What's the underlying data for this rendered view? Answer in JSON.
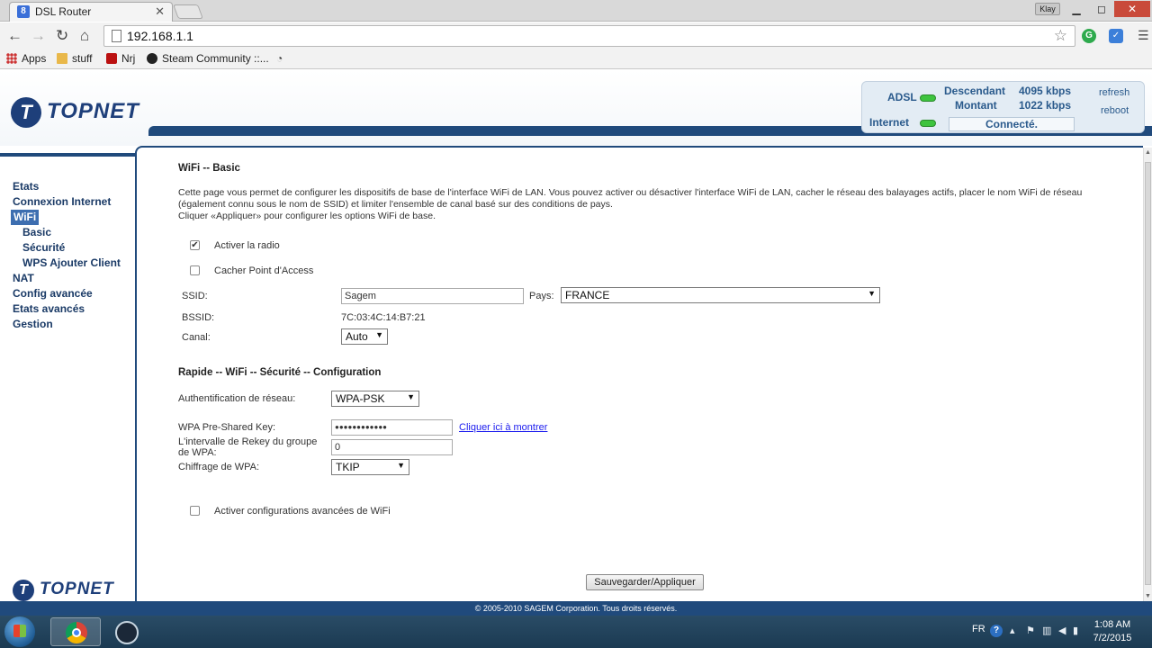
{
  "browser": {
    "tab_title": "DSL Router",
    "tab_favicon": "8",
    "close_glyph": "✕",
    "url": "192.168.1.1",
    "user_badge": "Klay",
    "bookmarks": [
      {
        "label": "Apps",
        "icon": "apps-icon"
      },
      {
        "label": "stuff",
        "icon": "folder-icon"
      },
      {
        "label": "Nrj",
        "icon": "nrj-icon"
      },
      {
        "label": "Steam Community ::...",
        "icon": "steam-icon"
      }
    ]
  },
  "header": {
    "logo_mark": "T",
    "logo_text": "TOPNET",
    "status": {
      "adsl_label": "ADSL",
      "internet_label": "Internet",
      "down_label": "Descendant",
      "down_value": "4095 kbps",
      "up_label": "Montant",
      "up_value": "1022 kbps",
      "connection": "Connecté.",
      "refresh": "refresh",
      "reboot": "reboot"
    }
  },
  "sidebar": {
    "items": [
      {
        "label": "Etats"
      },
      {
        "label": "Connexion Internet"
      },
      {
        "label": "WiFi"
      },
      {
        "label": "Basic"
      },
      {
        "label": "Sécurité"
      },
      {
        "label": "WPS Ajouter Client"
      },
      {
        "label": "NAT"
      },
      {
        "label": "Config avancée"
      },
      {
        "label": "Etats avancés"
      },
      {
        "label": "Gestion"
      }
    ],
    "footer_logo": "TOPNET"
  },
  "content": {
    "title": "WiFi -- Basic",
    "description_1": "Cette page vous permet de configurer les dispositifs de base de l'interface WiFi de LAN. Vous pouvez activer ou désactiver l'interface WiFi de LAN, cacher le réseau des balayages actifs, placer le nom WiFi de réseau (également connu sous le nom de SSID) et limiter l'ensemble de canal basé sur des conditions de pays.",
    "description_2": "Cliquer «Appliquer» pour configurer les options WiFi de base.",
    "enable_radio": {
      "label": "Activer la radio",
      "checked": "✔"
    },
    "hide_ap": {
      "label": "Cacher Point d'Access"
    },
    "ssid_label": "SSID:",
    "ssid_value": "Sagem",
    "country_label": "Pays:",
    "country_value": "FRANCE",
    "bssid_label": "BSSID:",
    "bssid_value": "7C:03:4C:14:B7:21",
    "channel_label": "Canal:",
    "channel_value": "Auto",
    "security_title": "Rapide -- WiFi -- Sécurité -- Configuration",
    "auth_label": "Authentification de réseau:",
    "auth_value": "WPA-PSK",
    "psk_label": "WPA Pre-Shared Key:",
    "psk_value": "●●●●●●●●●●●●",
    "psk_show_link": "Cliquer ici à montrer",
    "rekey_label": "L'intervalle de Rekey du groupe de WPA:",
    "rekey_value": "0",
    "encryption_label": "Chiffrage de WPA:",
    "encryption_value": "TKIP",
    "advanced_label": "Activer configurations avancées de WiFi",
    "save_button": "Sauvegarder/Appliquer",
    "select_arrow": "▼"
  },
  "footer": {
    "copyright": "© 2005-2010 SAGEM Corporation. Tous droits réservés."
  },
  "taskbar": {
    "language": "FR",
    "time": "1:08 AM",
    "date": "7/2/2015"
  }
}
